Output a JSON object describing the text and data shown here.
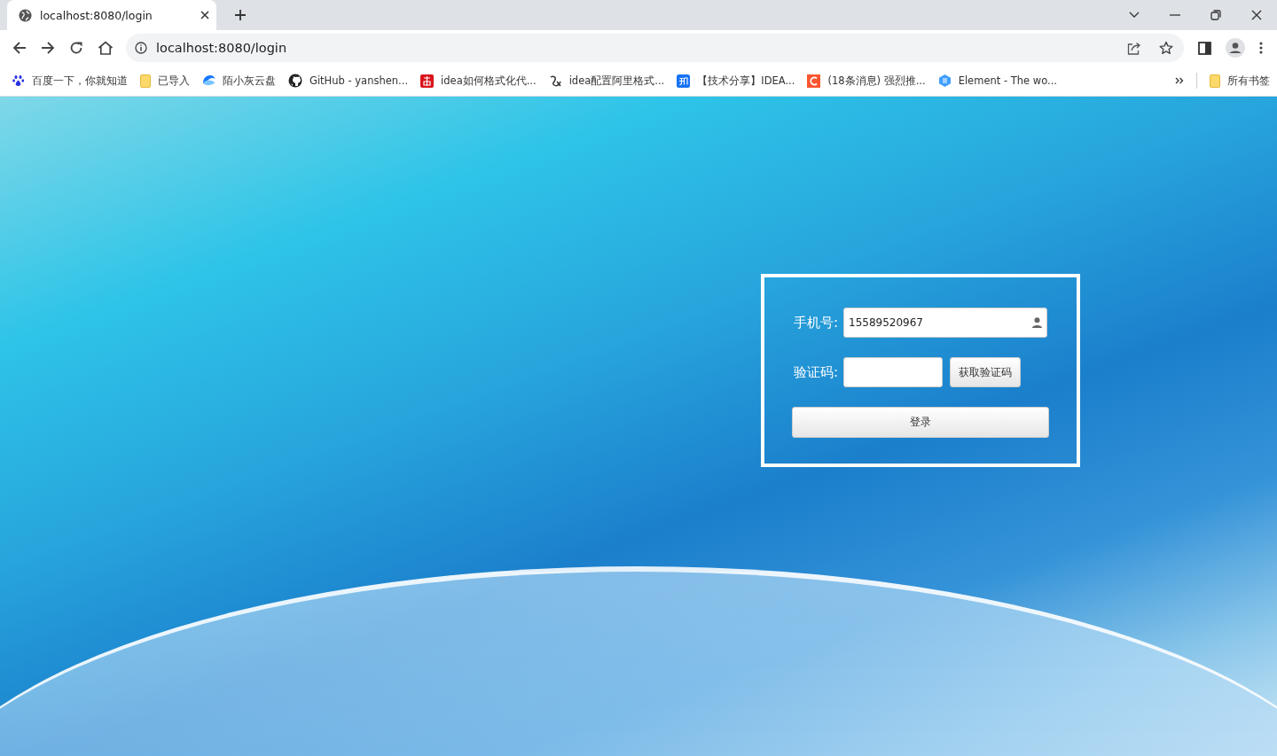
{
  "tabs": [
    {
      "title": "localhost:8080/login",
      "selected": true
    }
  ],
  "address_bar": {
    "url": "localhost:8080/login"
  },
  "bookmarks": [
    {
      "label": "百度一下，你就知道",
      "kind": "paw"
    },
    {
      "label": "已导入",
      "kind": "folder"
    },
    {
      "label": "陌小灰云盘",
      "kind": "cloud"
    },
    {
      "label": "GitHub - yanshen...",
      "kind": "github"
    },
    {
      "label": "idea如何格式化代...",
      "kind": "red"
    },
    {
      "label": "idea配置阿里格式...",
      "kind": "script"
    },
    {
      "label": "【技术分享】IDEA...",
      "kind": "zhi"
    },
    {
      "label": "(18条消息) 强烈推...",
      "kind": "csdn"
    },
    {
      "label": "Element - The wo...",
      "kind": "element"
    }
  ],
  "all_bookmarks": "所有书签",
  "login_form": {
    "phone_label": "手机号:",
    "phone_value": "15589520967",
    "code_label": "验证码:",
    "get_code_button": "获取验证码",
    "login_button": "登录"
  }
}
